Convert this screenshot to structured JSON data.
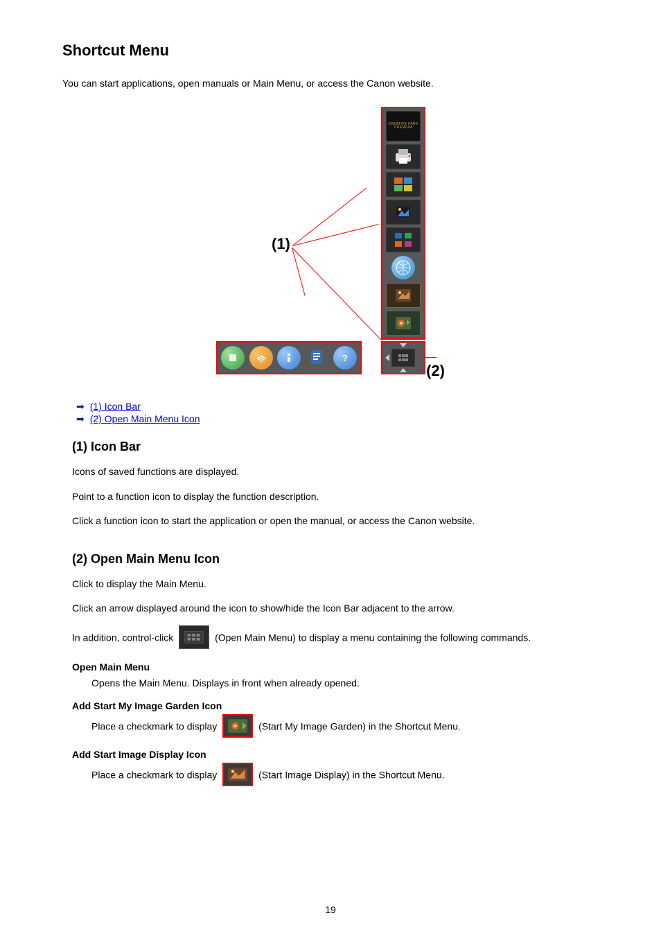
{
  "page": {
    "title": "Shortcut Menu",
    "intro": "You can start applications, open manuals or Main Menu, or access the Canon website.",
    "number": "19"
  },
  "figure": {
    "label_icon_bar": "(1)",
    "label_main_menu": "(2)",
    "creative_park_text": "CREATIVE PARK PREMIUM"
  },
  "nav": {
    "link_icon_bar": "(1) Icon Bar",
    "link_main_menu": "(2) Open Main Menu Icon"
  },
  "section1": {
    "heading": "(1) Icon Bar",
    "p1": "Icons of saved functions are displayed.",
    "p2": "Point to a function icon to display the function description.",
    "p3": "Click a function icon to start the application or open the manual, or access the Canon website."
  },
  "section2": {
    "heading": "(2) Open Main Menu Icon",
    "p1": "Click to display the Main Menu.",
    "p2": "Click an arrow displayed around the icon to show/hide the Icon Bar adjacent to the arrow.",
    "p3a": "In addition, control-click ",
    "p3b": " (Open Main Menu) to display a menu containing the following commands.",
    "dt1": "Open Main Menu",
    "dd1": "Opens the Main Menu. Displays in front when already opened.",
    "dt2": "Add Start My Image Garden Icon",
    "dd2a": "Place a checkmark to display ",
    "dd2b": " (Start My Image Garden) in the Shortcut Menu.",
    "dt3": "Add Start Image Display Icon",
    "dd3a": "Place a checkmark to display ",
    "dd3b": " (Start Image Display) in the Shortcut Menu."
  }
}
